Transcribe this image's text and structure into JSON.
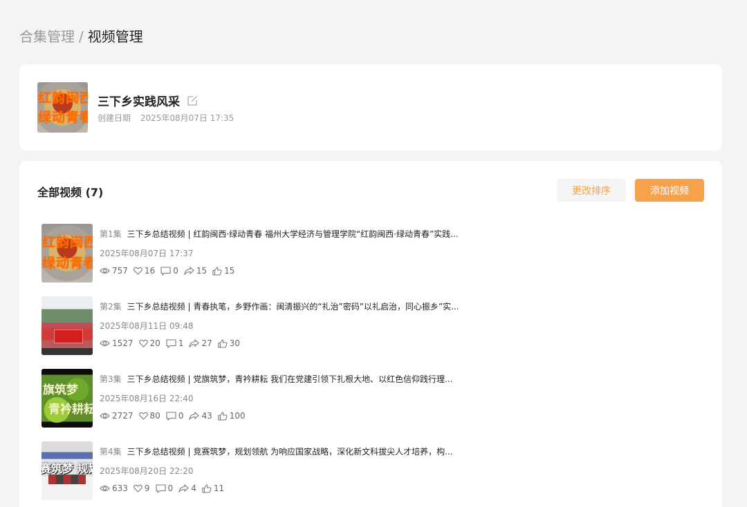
{
  "breadcrumb": {
    "parent": "合集管理",
    "separator": "/",
    "current": "视频管理"
  },
  "collection": {
    "title": "三下乡实践风采",
    "created_label": "创建日期",
    "created_date": "2025年08月07日 17:35",
    "cover_line1": "红韵闽西",
    "cover_line2": "绿动青春"
  },
  "videos_section": {
    "title": "全部视频 (7)",
    "sort_button": "更改排序",
    "add_button": "添加视频"
  },
  "videos": [
    {
      "episode": "第1集",
      "title": "三下乡总结视频 | 红韵闽西·绿动青春 福州大学经济与管理学院“红韵闽西·绿动青春”实践...",
      "date": "2025年08月07日 17:37",
      "views": "757",
      "likes": "16",
      "comments": "0",
      "shares": "15",
      "thumbs": "15",
      "thumb_line1": "红韵闽西",
      "thumb_line2": "绿动青春"
    },
    {
      "episode": "第2集",
      "title": "三下乡总结视频 | 青春执笔，乡野作画：闽清振兴的“礼治”密码”以礼启治，同心振乡”实...",
      "date": "2025年08月11日 09:48",
      "views": "1527",
      "likes": "20",
      "comments": "1",
      "shares": "27",
      "thumbs": "30"
    },
    {
      "episode": "第3集",
      "title": "三下乡总结视频 | 党旗筑梦，青衿耕耘 我们在党建引领下扎根大地、以红色信仰践行理...",
      "date": "2025年08月16日 22:40",
      "views": "2727",
      "likes": "80",
      "comments": "0",
      "shares": "43",
      "thumbs": "100",
      "thumb_line1": "旗筑梦",
      "thumb_line2": "青衿耕耘"
    },
    {
      "episode": "第4集",
      "title": "三下乡总结视频 | 竞赛筑梦，规划领航 为响应国家战略，深化新文科拔尖人才培养，构...",
      "date": "2025年08月20日 22:20",
      "views": "633",
      "likes": "9",
      "comments": "0",
      "shares": "4",
      "thumbs": "11",
      "thumb_line1": "赛筑梦 规划领"
    }
  ],
  "colors": {
    "accent": "#f7a14a",
    "accent_text": "#f5a04a",
    "background": "#f4f4f5",
    "card": "#ffffff"
  },
  "icons": {
    "edit": "edit-icon",
    "views": "eye-icon",
    "likes": "heart-icon",
    "comments": "comment-icon",
    "shares": "share-icon",
    "thumbs": "thumbs-up-icon"
  }
}
